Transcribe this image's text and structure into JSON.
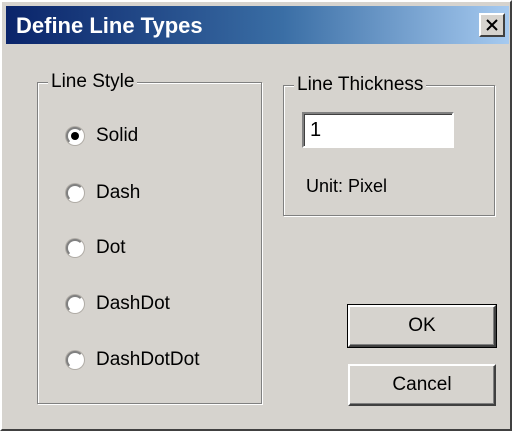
{
  "window": {
    "title": "Define Line Types",
    "close_glyph": "close-icon"
  },
  "line_style": {
    "label": "Line Style",
    "selected": "Solid",
    "options": [
      {
        "label": "Solid",
        "checked": true
      },
      {
        "label": "Dash",
        "checked": false
      },
      {
        "label": "Dot",
        "checked": false
      },
      {
        "label": "DashDot",
        "checked": false
      },
      {
        "label": "DashDotDot",
        "checked": false
      }
    ]
  },
  "line_thickness": {
    "label": "Line Thickness",
    "value": "1",
    "unit_text": "Unit:  Pixel"
  },
  "buttons": {
    "ok": "OK",
    "cancel": "Cancel"
  },
  "colors": {
    "dialog_bg": "#d6d3ce",
    "title_gradient_start": "#0a246a",
    "title_gradient_end": "#a6caf0",
    "title_text": "#ffffff"
  }
}
